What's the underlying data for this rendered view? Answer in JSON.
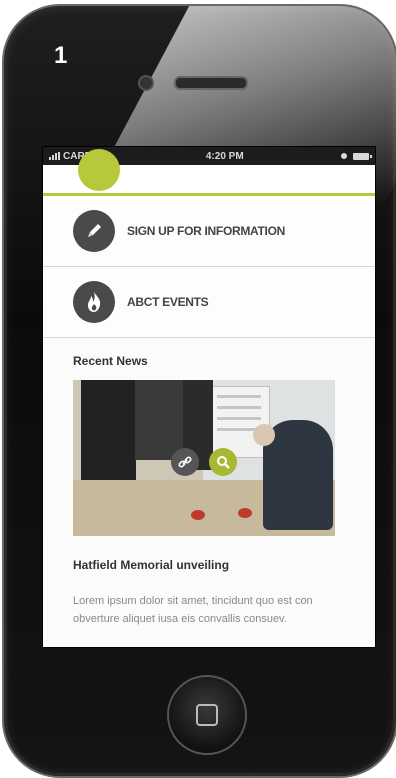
{
  "step_number": "1",
  "status_bar": {
    "carrier": "CARRIER",
    "time": "4:20 PM"
  },
  "menu": [
    {
      "label": "SIGN UP FOR INFORMATION",
      "icon": "pencil-icon"
    },
    {
      "label": "ABCT EVENTS",
      "icon": "flame-icon"
    }
  ],
  "news": {
    "heading": "Recent News",
    "image_overlay_icons": [
      "link-icon",
      "magnifier-icon"
    ],
    "title": "Hatfield Memorial unveiling",
    "excerpt": "Lorem ipsum dolor sit amet, tincidunt quo est con obverture aliquet iusa eis convallis consuev."
  },
  "colors": {
    "accent": "#b7c83b",
    "icon_bg": "#4a4a4a",
    "phone_body": "#111111"
  }
}
